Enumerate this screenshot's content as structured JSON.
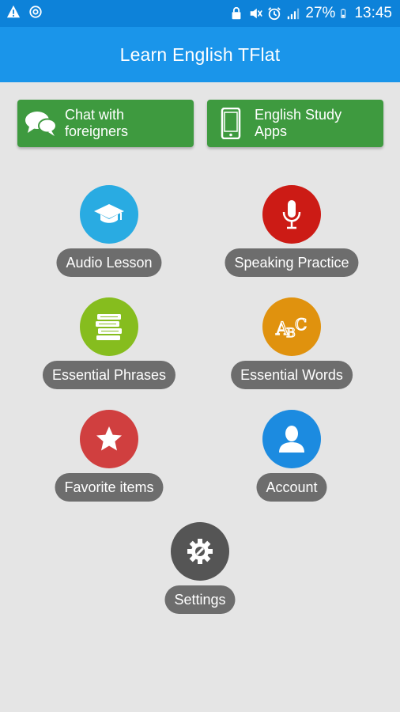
{
  "status_bar": {
    "battery": "27%",
    "time": "13:45"
  },
  "app_bar": {
    "title": "Learn English TFlat"
  },
  "top_buttons": [
    {
      "label": "Chat with\nforeigners",
      "icon": "chat-bubbles-icon"
    },
    {
      "label": "English Study\nApps",
      "icon": "smartphone-icon"
    }
  ],
  "features": [
    {
      "label": "Audio Lesson",
      "icon": "graduation-cap-icon",
      "color": "#29abe2"
    },
    {
      "label": "Speaking Practice",
      "icon": "microphone-icon",
      "color": "#cc1b15"
    },
    {
      "label": "Essential Phrases",
      "icon": "books-icon",
      "color": "#86bd1e"
    },
    {
      "label": "Essential Words",
      "icon": "abc-icon",
      "color": "#e0920e"
    },
    {
      "label": "Favorite items",
      "icon": "star-icon",
      "color": "#d03f3f"
    },
    {
      "label": "Account",
      "icon": "user-icon",
      "color": "#1c8be0"
    },
    {
      "label": "Settings",
      "icon": "gear-wrench-icon",
      "color": "#555555"
    }
  ],
  "colors": {
    "status_bar": "#0d82d9",
    "app_bar": "#1a95ea",
    "top_button": "#3e9a3f",
    "pill": "#6d6d6d",
    "background": "#e5e5e5"
  }
}
